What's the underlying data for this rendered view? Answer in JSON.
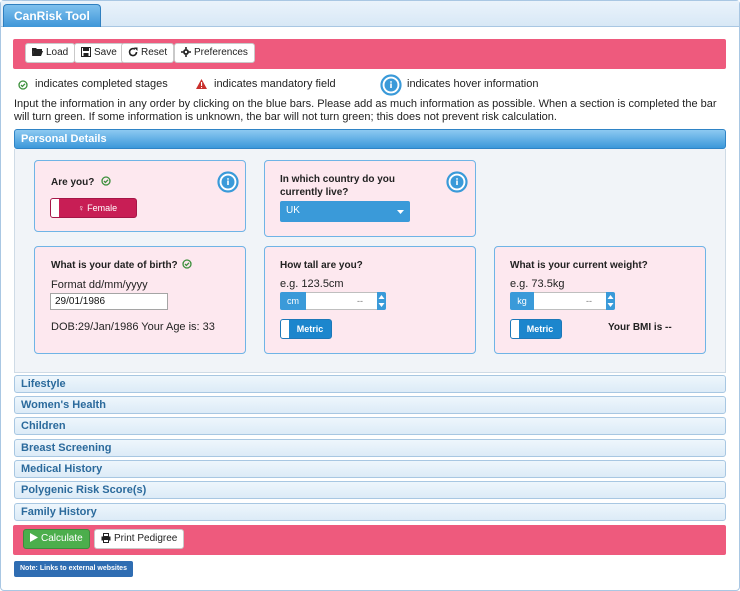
{
  "app": {
    "tab_title": "CanRisk Tool"
  },
  "toolbar": {
    "load": "Load",
    "save": "Save",
    "reset": "Reset",
    "preferences": "Preferences"
  },
  "legend": {
    "completed": "indicates completed stages",
    "mandatory": "indicates mandatory field",
    "hover": "indicates hover information"
  },
  "intro": "Input the information in any order by clicking on the blue bars. Please add as much information as possible. When a section is completed the bar will turn green. If some information is unknown, the bar will not turn green; this does not prevent risk calculation.",
  "sections": {
    "personal_details": "Personal Details",
    "collapsed": [
      "Lifestyle",
      "Women's Health",
      "Children",
      "Breast Screening",
      "Medical History",
      "Polygenic Risk Score(s)",
      "Family History"
    ]
  },
  "personal": {
    "sex": {
      "question": "Are you?",
      "value": "Female",
      "icon": "female-icon"
    },
    "country": {
      "question": "In which country do you currently live?",
      "value": "UK"
    },
    "dob": {
      "question": "What is your date of birth?",
      "format_hint": "Format dd/mm/yyyy",
      "value": "29/01/1986",
      "summary": "DOB:29/Jan/1986 Your Age is: 33"
    },
    "height": {
      "question": "How tall are you?",
      "example": "e.g. 123.5cm",
      "unit": "cm",
      "value": "--",
      "toggle": "Metric"
    },
    "weight": {
      "question": "What is your current weight?",
      "example": "e.g. 73.5kg",
      "unit": "kg",
      "value": "--",
      "toggle": "Metric",
      "bmi": "Your BMI is --"
    }
  },
  "bottom": {
    "calculate": "Calculate",
    "print": "Print Pedigree",
    "note": "Note: Links to external websites"
  },
  "colors": {
    "accent_pink": "#ee5a7d",
    "primary_blue": "#3a9ad9",
    "female_toggle": "#c81e55",
    "card_bg": "#fde8ef",
    "success_green": "#4cae4c",
    "warning_red": "#c9302c"
  }
}
